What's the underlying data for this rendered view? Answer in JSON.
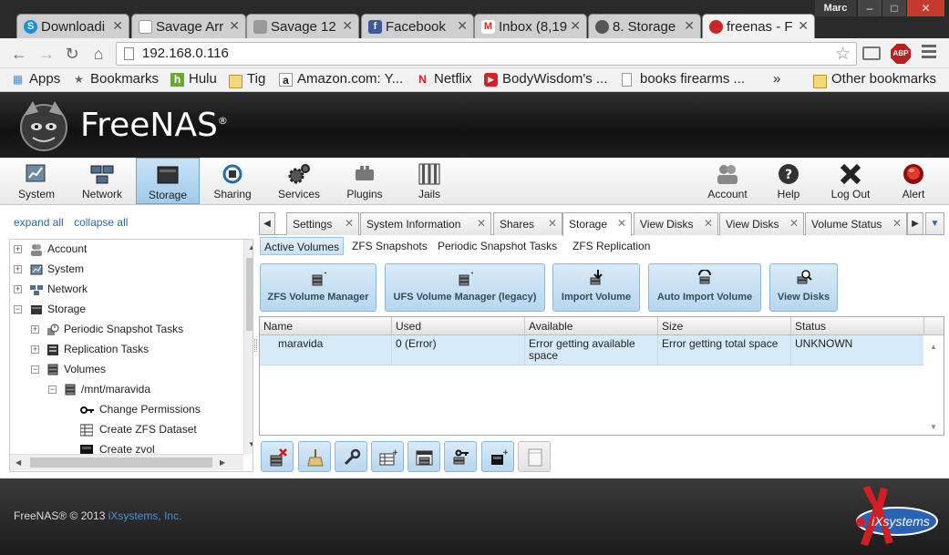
{
  "browser": {
    "tabs": [
      {
        "label": "Downloadi",
        "icon": "skype-icon",
        "color": "#1c8fd6"
      },
      {
        "label": "Savage Arr",
        "icon": "page-icon",
        "color": "#ffffff"
      },
      {
        "label": "Savage 12",
        "icon": "gun-icon",
        "color": "#777777"
      },
      {
        "label": "Facebook",
        "icon": "facebook-icon",
        "color": "#3b5998"
      },
      {
        "label": "Inbox (8,19",
        "icon": "gmail-icon",
        "color": "#d93025"
      },
      {
        "label": "8. Storage",
        "icon": "freenas-icon",
        "color": "#555555"
      },
      {
        "label": "freenas - F",
        "icon": "freenas-red-icon",
        "color": "#c62828"
      }
    ],
    "user": "Marc",
    "window_controls": [
      "–",
      "□",
      "✕"
    ],
    "url": "192.168.0.116",
    "abp_label": "ABP",
    "bookmarks": [
      {
        "label": "Apps",
        "icon": "apps-grid-icon"
      },
      {
        "label": "Bookmarks",
        "icon": "star-icon"
      },
      {
        "label": "Hulu",
        "icon": "hulu-icon"
      },
      {
        "label": "Tig",
        "icon": "folder-icon"
      },
      {
        "label": "Amazon.com: Y...",
        "icon": "amazon-icon"
      },
      {
        "label": "Netflix",
        "icon": "netflix-icon"
      },
      {
        "label": "BodyWisdom's ...",
        "icon": "youtube-icon"
      },
      {
        "label": "books firearms ...",
        "icon": "page-icon"
      },
      {
        "label": "»",
        "icon": ""
      },
      {
        "label": "Other bookmarks",
        "icon": "folder-icon"
      }
    ]
  },
  "app": {
    "logo_text": "FreeNAS",
    "nav": [
      {
        "label": "System",
        "icon": "system-icon"
      },
      {
        "label": "Network",
        "icon": "network-icon"
      },
      {
        "label": "Storage",
        "icon": "storage-icon",
        "active": true
      },
      {
        "label": "Sharing",
        "icon": "sharing-icon"
      },
      {
        "label": "Services",
        "icon": "services-icon"
      },
      {
        "label": "Plugins",
        "icon": "plugins-icon"
      },
      {
        "label": "Jails",
        "icon": "jails-icon"
      },
      {
        "label": "Account",
        "icon": "account-icon"
      },
      {
        "label": "Help",
        "icon": "help-icon"
      },
      {
        "label": "Log Out",
        "icon": "logout-icon"
      },
      {
        "label": "Alert",
        "icon": "alert-icon"
      }
    ]
  },
  "tree": {
    "expand_all": "expand all",
    "collapse_all": "collapse all",
    "items": [
      {
        "label": "Account",
        "expander": "+"
      },
      {
        "label": "System",
        "expander": "+"
      },
      {
        "label": "Network",
        "expander": "+"
      },
      {
        "label": "Storage",
        "expander": "−"
      },
      {
        "label": "Periodic Snapshot Tasks",
        "expander": "+"
      },
      {
        "label": "Replication Tasks",
        "expander": "+"
      },
      {
        "label": "Volumes",
        "expander": "−"
      },
      {
        "label": "/mnt/maravida",
        "expander": "−"
      },
      {
        "label": "Change Permissions",
        "expander": ""
      },
      {
        "label": "Create ZFS Dataset",
        "expander": ""
      },
      {
        "label": "Create zvol",
        "expander": ""
      }
    ]
  },
  "content": {
    "tabs": [
      "Settings",
      "System Information",
      "Shares",
      "Storage",
      "View Disks",
      "View Disks",
      "Volume Status"
    ],
    "active_tab": "Storage",
    "subtabs": [
      "Active Volumes",
      "ZFS Snapshots",
      "Periodic Snapshot Tasks",
      "ZFS Replication"
    ],
    "buttons": [
      "ZFS Volume Manager",
      "UFS Volume Manager (legacy)",
      "Import Volume",
      "Auto Import Volume",
      "View Disks"
    ],
    "columns": [
      "Name",
      "Used",
      "Available",
      "Size",
      "Status"
    ],
    "rows": [
      {
        "name": "maravida",
        "used": "0 (Error)",
        "available": "Error getting available space",
        "size": "Error getting total space",
        "status": "UNKNOWN"
      }
    ],
    "action_buttons": [
      {
        "name": "detach-volume-button",
        "icon": "detach-volume-icon"
      },
      {
        "name": "scrub-volume-button",
        "icon": "scrub-icon"
      },
      {
        "name": "edit-zfs-options-button",
        "icon": "wrench-icon"
      },
      {
        "name": "create-zfs-dataset-button",
        "icon": "dataset-add-icon"
      },
      {
        "name": "create-zvol-button",
        "icon": "zvol-add-icon"
      },
      {
        "name": "change-permissions-button",
        "icon": "permissions-icon"
      },
      {
        "name": "create-snapshot-button",
        "icon": "snapshot-icon"
      },
      {
        "name": "volume-status-button",
        "icon": "volume-status-icon",
        "disabled": true
      }
    ]
  },
  "footer": {
    "copyright": "FreeNAS® © 2013",
    "company": "iXsystems, Inc.",
    "logo_text": "iXsystems"
  }
}
